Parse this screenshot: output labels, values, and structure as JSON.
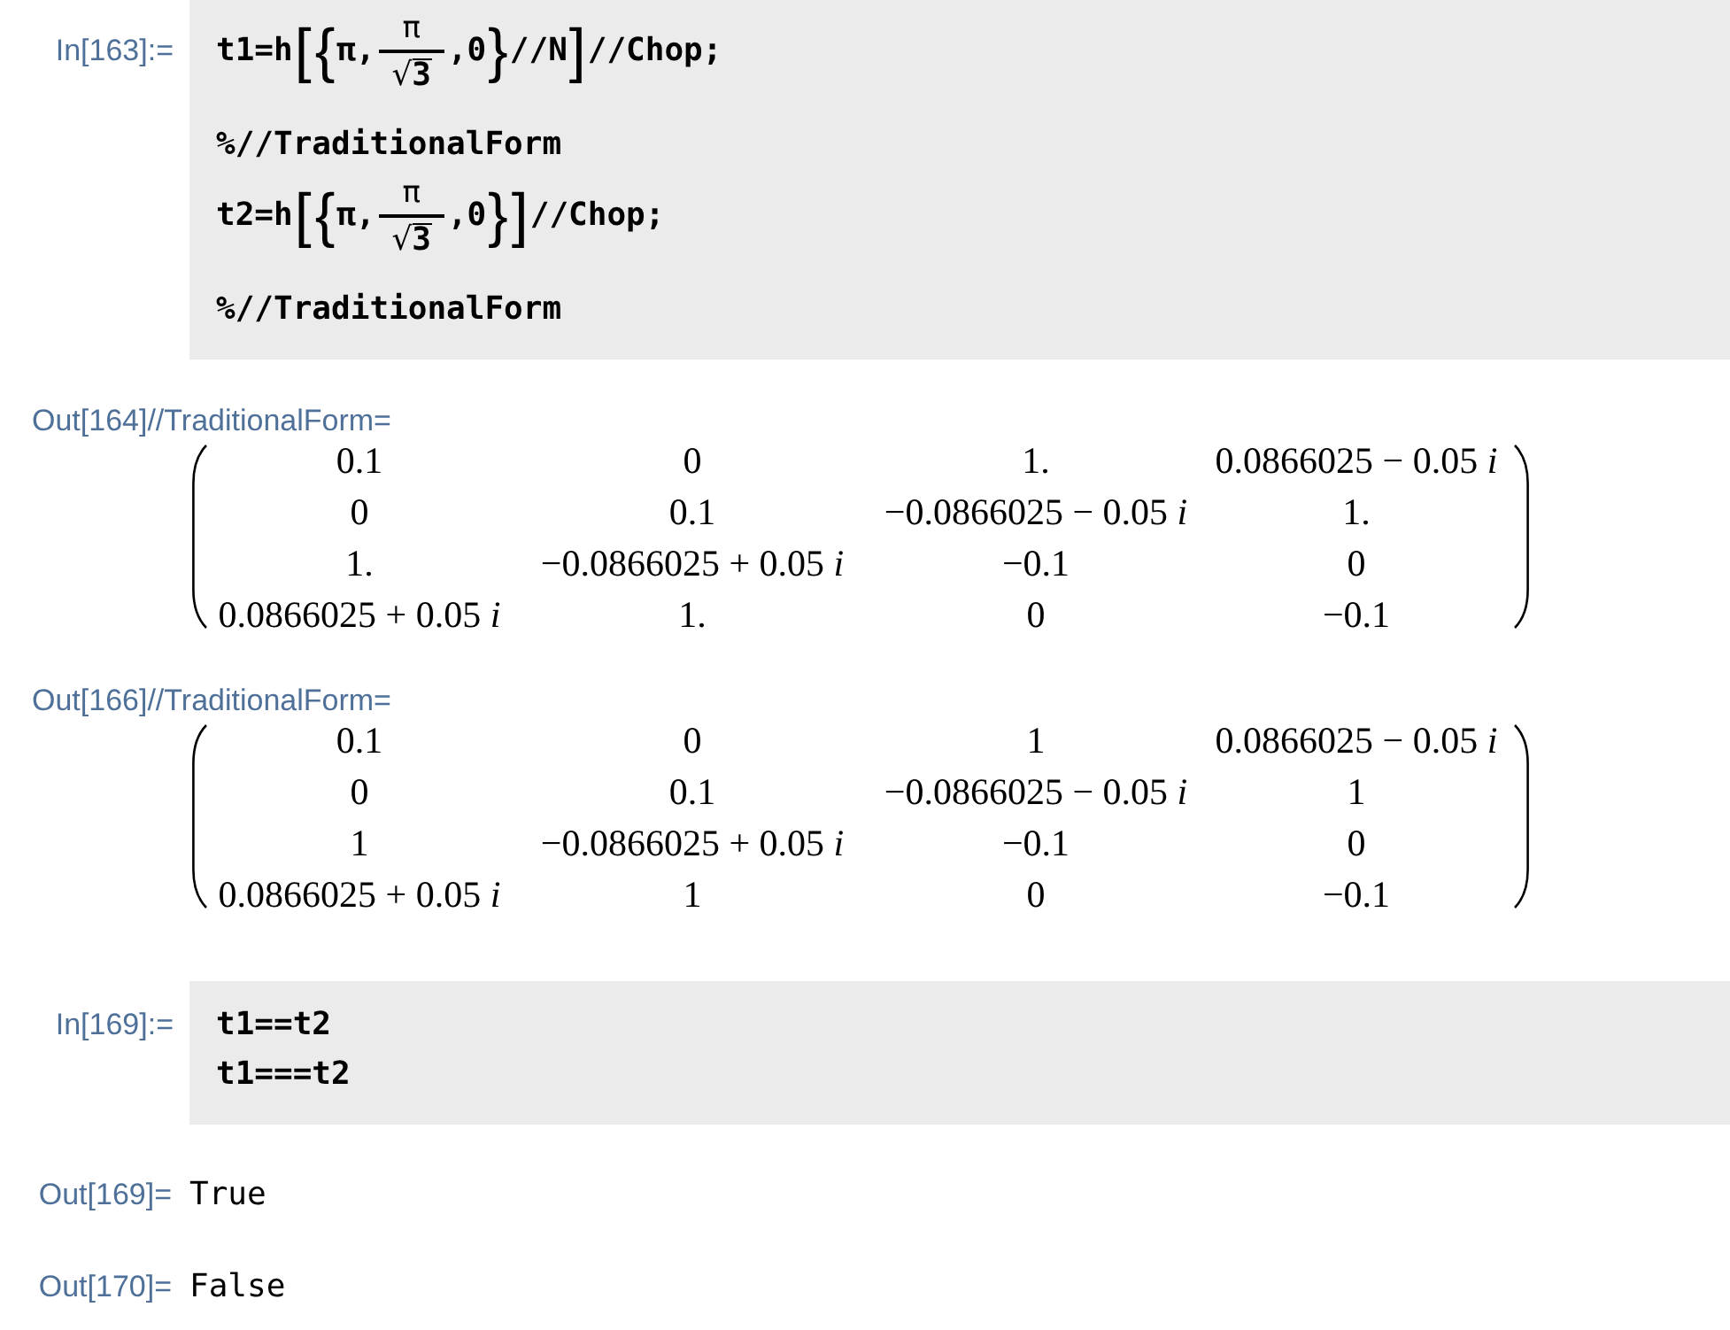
{
  "cells": [
    {
      "kind": "input",
      "label": "In[163]:=",
      "lines": [
        [
          {
            "kind": "code",
            "text": "t1=h"
          },
          {
            "kind": "bracket",
            "text": "["
          },
          {
            "kind": "bracket",
            "text": "{"
          },
          {
            "kind": "code",
            "text": "π,"
          },
          {
            "kind": "fraction",
            "numerator": "π",
            "radical": "√",
            "radicand": "3"
          },
          {
            "kind": "code",
            "text": ",0"
          },
          {
            "kind": "bracket",
            "text": "}"
          },
          {
            "kind": "code",
            "text": "//N"
          },
          {
            "kind": "bracket",
            "text": "]"
          },
          {
            "kind": "code",
            "text": "//Chop;"
          }
        ],
        [
          {
            "kind": "code",
            "text": "%//TraditionalForm"
          }
        ],
        [
          {
            "kind": "code",
            "text": "t2=h"
          },
          {
            "kind": "bracket",
            "text": "["
          },
          {
            "kind": "bracket",
            "text": "{"
          },
          {
            "kind": "code",
            "text": "π,"
          },
          {
            "kind": "fraction",
            "numerator": "π",
            "radical": "√",
            "radicand": "3"
          },
          {
            "kind": "code",
            "text": ",0"
          },
          {
            "kind": "bracket",
            "text": "}"
          },
          {
            "kind": "bracket",
            "text": "]"
          },
          {
            "kind": "code",
            "text": "//Chop;"
          }
        ],
        [
          {
            "kind": "code",
            "text": "%//TraditionalForm"
          }
        ]
      ]
    },
    {
      "kind": "matrix_output",
      "label": "Out[164]//TraditionalForm=",
      "rows": [
        [
          "0.1",
          "0",
          "1.",
          "0.0866025 − 0.05 *i*"
        ],
        [
          "0",
          "0.1",
          "−0.0866025 − 0.05 *i*",
          "1."
        ],
        [
          "1.",
          "−0.0866025 + 0.05 *i*",
          "−0.1",
          "0"
        ],
        [
          "0.0866025 + 0.05 *i*",
          "1.",
          "0",
          "−0.1"
        ]
      ]
    },
    {
      "kind": "matrix_output",
      "label": "Out[166]//TraditionalForm=",
      "rows": [
        [
          "0.1",
          "0",
          "1",
          "0.0866025 − 0.05 *i*"
        ],
        [
          "0",
          "0.1",
          "−0.0866025 − 0.05 *i*",
          "1"
        ],
        [
          "1",
          "−0.0866025 + 0.05 *i*",
          "−0.1",
          "0"
        ],
        [
          "0.0866025 + 0.05 *i*",
          "1",
          "0",
          "−0.1"
        ]
      ]
    },
    {
      "kind": "input",
      "label": "In[169]:=",
      "lines": [
        [
          {
            "kind": "code",
            "text": "t1==t2"
          }
        ],
        [
          {
            "kind": "code",
            "text": "t1===t2"
          }
        ]
      ]
    },
    {
      "kind": "text_output",
      "label": "Out[169]=",
      "value": "True"
    },
    {
      "kind": "text_output",
      "label": "Out[170]=",
      "value": "False"
    }
  ]
}
